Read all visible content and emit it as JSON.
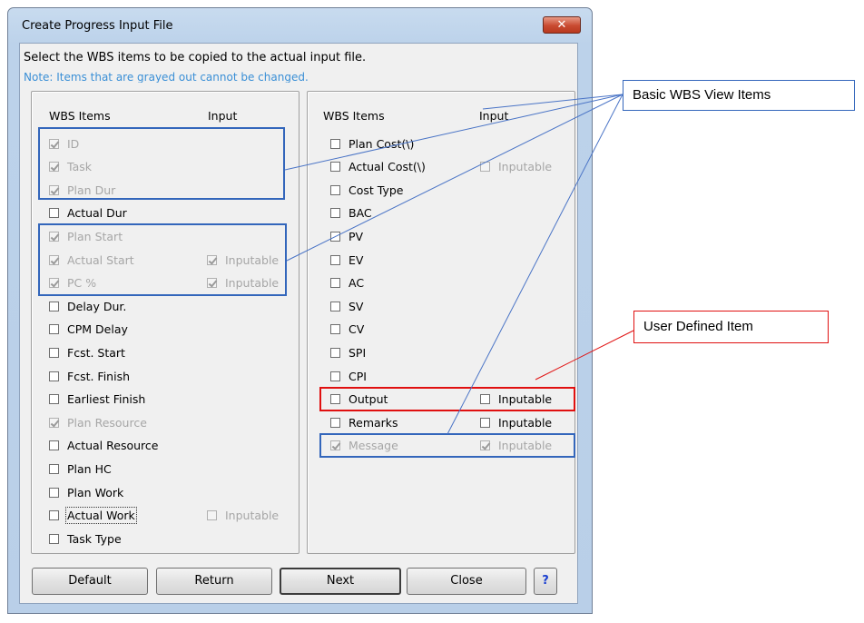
{
  "window": {
    "title": "Create Progress Input File",
    "close_glyph": "✕",
    "instruction": "Select the WBS items to be copied to the actual input file.",
    "note": "Note: Items that are grayed out cannot be changed."
  },
  "left_panel": {
    "header_item": "WBS Items",
    "header_input": "Input",
    "items": [
      {
        "label": "ID",
        "checked": true,
        "disabled": true
      },
      {
        "label": "Task",
        "checked": true,
        "disabled": true
      },
      {
        "label": "Plan Dur",
        "checked": true,
        "disabled": true
      },
      {
        "label": "Actual Dur",
        "checked": false,
        "disabled": false
      },
      {
        "label": "Plan Start",
        "checked": true,
        "disabled": true
      },
      {
        "label": "Actual Start",
        "checked": true,
        "disabled": true,
        "input": "Inputable",
        "input_checked": true,
        "input_disabled": true
      },
      {
        "label": "PC %",
        "checked": true,
        "disabled": true,
        "input": "Inputable",
        "input_checked": true,
        "input_disabled": true
      },
      {
        "label": "Delay Dur.",
        "checked": false,
        "disabled": false
      },
      {
        "label": "CPM Delay",
        "checked": false,
        "disabled": false
      },
      {
        "label": "Fcst. Start",
        "checked": false,
        "disabled": false
      },
      {
        "label": "Fcst. Finish",
        "checked": false,
        "disabled": false
      },
      {
        "label": "Earliest Finish",
        "checked": false,
        "disabled": false
      },
      {
        "label": "Plan Resource",
        "checked": true,
        "disabled": true
      },
      {
        "label": "Actual Resource",
        "checked": false,
        "disabled": false
      },
      {
        "label": "Plan HC",
        "checked": false,
        "disabled": false
      },
      {
        "label": "Plan Work",
        "checked": false,
        "disabled": false
      },
      {
        "label": "Actual Work",
        "checked": false,
        "disabled": false,
        "focused": true,
        "input": "Inputable",
        "input_checked": false,
        "input_disabled": true
      },
      {
        "label": "Task Type",
        "checked": false,
        "disabled": false
      }
    ]
  },
  "right_panel": {
    "header_item": "WBS Items",
    "header_input": "Input",
    "items": [
      {
        "label": "Plan Cost(\\)",
        "checked": false,
        "disabled": false
      },
      {
        "label": "Actual Cost(\\)",
        "checked": false,
        "disabled": false,
        "input": "Inputable",
        "input_checked": false,
        "input_disabled": true
      },
      {
        "label": "Cost Type",
        "checked": false,
        "disabled": false
      },
      {
        "label": "BAC",
        "checked": false,
        "disabled": false
      },
      {
        "label": "PV",
        "checked": false,
        "disabled": false
      },
      {
        "label": "EV",
        "checked": false,
        "disabled": false
      },
      {
        "label": "AC",
        "checked": false,
        "disabled": false
      },
      {
        "label": "SV",
        "checked": false,
        "disabled": false
      },
      {
        "label": "CV",
        "checked": false,
        "disabled": false
      },
      {
        "label": "SPI",
        "checked": false,
        "disabled": false
      },
      {
        "label": "CPI",
        "checked": false,
        "disabled": false
      },
      {
        "label": "Output",
        "checked": false,
        "disabled": false,
        "input": "Inputable",
        "input_checked": false,
        "input_disabled": false
      },
      {
        "label": "Remarks",
        "checked": false,
        "disabled": false,
        "input": "Inputable",
        "input_checked": false,
        "input_disabled": false
      },
      {
        "label": "Message",
        "checked": true,
        "disabled": true,
        "input": "Inputable",
        "input_checked": true,
        "input_disabled": true
      }
    ]
  },
  "buttons": {
    "default": "Default",
    "return": "Return",
    "next": "Next",
    "close": "Close",
    "help": "?"
  },
  "annotations": {
    "basic": "Basic WBS View Items",
    "user_defined": "User Defined Item",
    "blue": "#3366bb",
    "red": "#e01010"
  }
}
